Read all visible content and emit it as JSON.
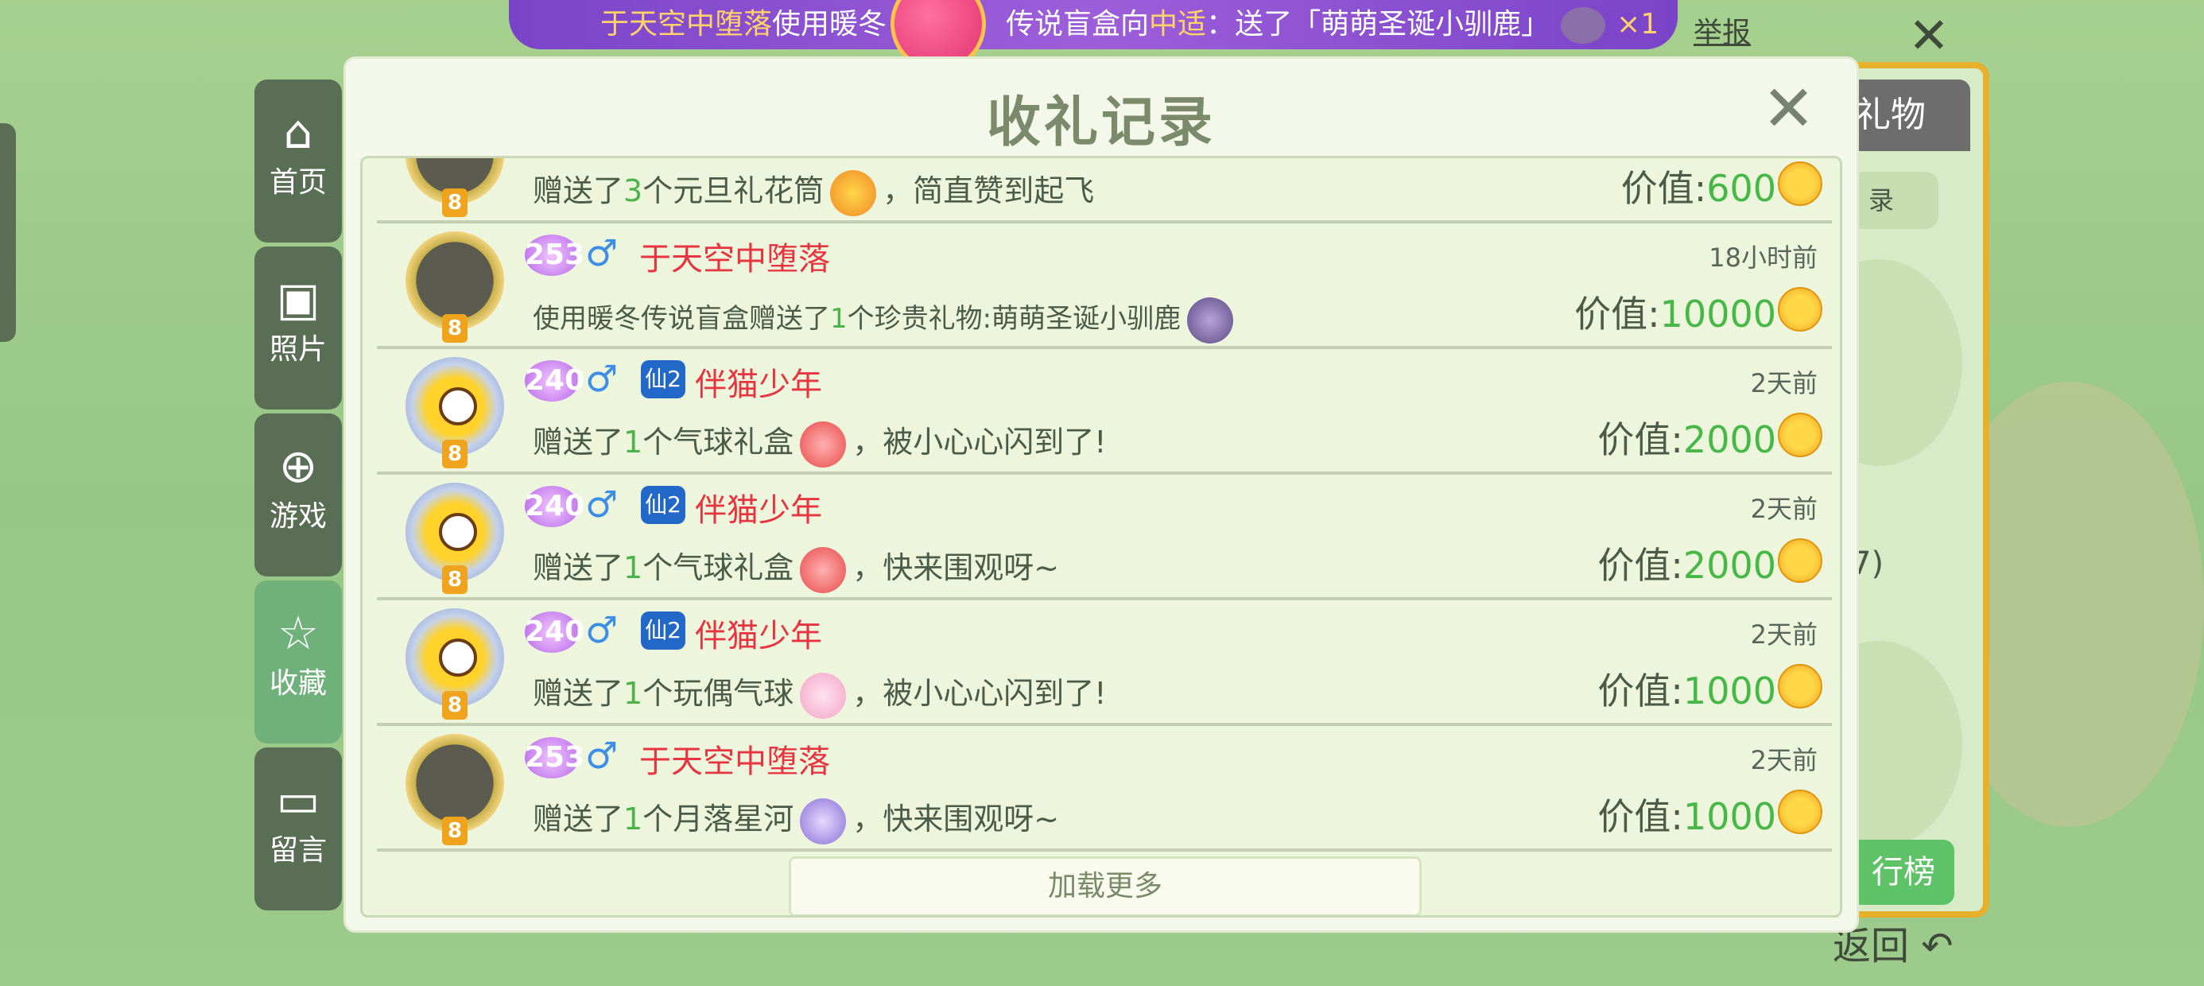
{
  "banner": {
    "name": "于天空中堕落",
    "text1": "使用暖冬",
    "hidden_part": "传说盲盒向",
    "target": "中适",
    "text2": "：送了「萌萌圣诞小驯鹿」",
    "count": "×1"
  },
  "report_label": "举报",
  "nav": [
    {
      "label": "首页",
      "icon": "home-icon"
    },
    {
      "label": "照片",
      "icon": "photo-icon"
    },
    {
      "label": "游戏",
      "icon": "gamepad-icon"
    },
    {
      "label": "收藏",
      "icon": "star-icon"
    },
    {
      "label": "留言",
      "icon": "message-icon"
    }
  ],
  "right_panel": {
    "gift_tab": "礼物",
    "record_btn": "录",
    "partial": "7)",
    "rank_btn": "行榜"
  },
  "back_label": "返回",
  "modal": {
    "title": "收礼记录",
    "load_more": "加载更多",
    "rows": [
      {
        "level": "",
        "name": "",
        "time": "",
        "desc_pre": "赠送了",
        "num": "3",
        "desc_mid": "个元旦礼花筒",
        "desc_post": "，简直赞到起飞",
        "value_label": "价值:",
        "value": "600",
        "avatar_level": "8"
      },
      {
        "level": "253",
        "name": "于天空中堕落",
        "time": "18小时前",
        "desc_pre": "使用暖冬传说盲盒赠送了",
        "num": "1",
        "desc_mid": "个珍贵礼物:萌萌圣诞小驯鹿",
        "desc_post": "",
        "value_label": "价值:",
        "value": "10000",
        "avatar_level": "8"
      },
      {
        "level": "240",
        "name": "伴猫少年",
        "time": "2天前",
        "desc_pre": "赠送了",
        "num": "1",
        "desc_mid": "个气球礼盒",
        "desc_post": "，被小心心闪到了!",
        "value_label": "价值:",
        "value": "2000",
        "avatar_level": "8",
        "vip": "仙2"
      },
      {
        "level": "240",
        "name": "伴猫少年",
        "time": "2天前",
        "desc_pre": "赠送了",
        "num": "1",
        "desc_mid": "个气球礼盒",
        "desc_post": "，快来围观呀~",
        "value_label": "价值:",
        "value": "2000",
        "avatar_level": "8",
        "vip": "仙2"
      },
      {
        "level": "240",
        "name": "伴猫少年",
        "time": "2天前",
        "desc_pre": "赠送了",
        "num": "1",
        "desc_mid": "个玩偶气球",
        "desc_post": "，被小心心闪到了!",
        "value_label": "价值:",
        "value": "1000",
        "avatar_level": "8",
        "vip": "仙2"
      },
      {
        "level": "253",
        "name": "于天空中堕落",
        "time": "2天前",
        "desc_pre": "赠送了",
        "num": "1",
        "desc_mid": "个月落星河",
        "desc_post": "，快来围观呀~",
        "value_label": "价值:",
        "value": "1000",
        "avatar_level": "8"
      }
    ]
  },
  "colors": {
    "accent_green": "#47b747",
    "name_red": "#e63540",
    "banner_purple": "#7a44c9",
    "coin_gold": "#f0a11c"
  }
}
